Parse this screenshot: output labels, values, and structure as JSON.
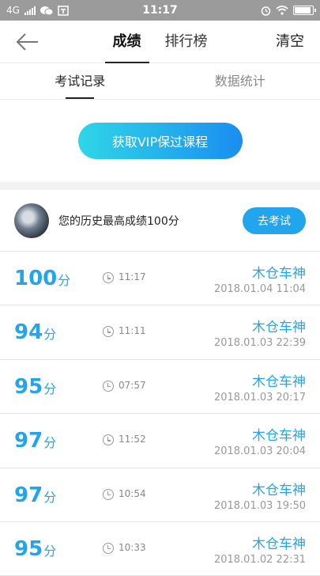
{
  "status_bar": {
    "network": "4G",
    "time": "11:17"
  },
  "header": {
    "tabs": [
      {
        "label": "成绩"
      },
      {
        "label": "排行榜"
      }
    ],
    "clear_label": "清空"
  },
  "subtabs": [
    {
      "label": "考试记录"
    },
    {
      "label": "数据统计"
    }
  ],
  "vip_button_label": "获取VIP保过课程",
  "best": {
    "text": "您的历史最高成绩100分",
    "button_label": "去考试"
  },
  "score_unit": "分",
  "records": [
    {
      "score": "100",
      "duration": "11:17",
      "user": "木仓车神",
      "date": "2018.01.04  11:04"
    },
    {
      "score": "94",
      "duration": "11:11",
      "user": "木仓车神",
      "date": "2018.01.03  22:39"
    },
    {
      "score": "95",
      "duration": "07:57",
      "user": "木仓车神",
      "date": "2018.01.03  20:17"
    },
    {
      "score": "97",
      "duration": "11:52",
      "user": "木仓车神",
      "date": "2018.01.03  20:04"
    },
    {
      "score": "97",
      "duration": "10:54",
      "user": "木仓车神",
      "date": "2018.01.03  19:50"
    },
    {
      "score": "95",
      "duration": "10:33",
      "user": "木仓车神",
      "date": "2018.01.02  22:31"
    }
  ],
  "colors": {
    "accent": "#21a6ee",
    "status_bar": "#9b9b9b"
  }
}
